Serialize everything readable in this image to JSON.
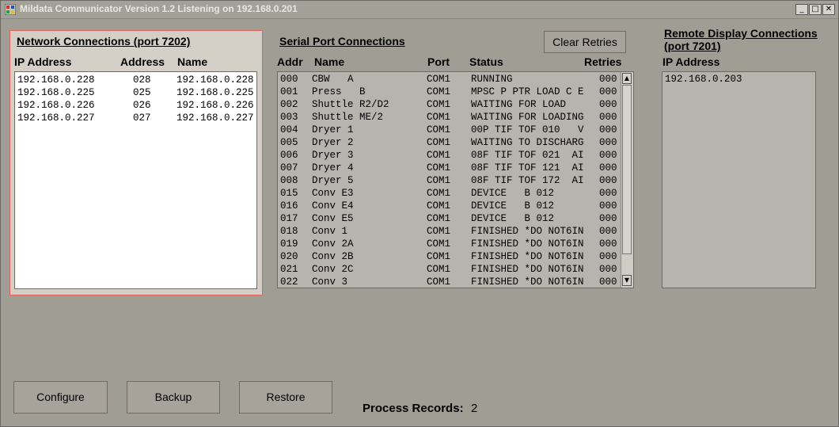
{
  "window": {
    "title": "Mildata Communicator Version 1.2 Listening on 192.168.0.201",
    "minimize": "_",
    "maximize": "□",
    "close": "✕"
  },
  "network": {
    "title": "Network Connections (port 7202)",
    "headers": {
      "ip": "IP Address",
      "address": "Address",
      "name": "Name"
    },
    "rows": [
      {
        "ip": "192.168.0.228",
        "address": "028",
        "name": "192.168.0.228"
      },
      {
        "ip": "192.168.0.225",
        "address": "025",
        "name": "192.168.0.225"
      },
      {
        "ip": "192.168.0.226",
        "address": "026",
        "name": "192.168.0.226"
      },
      {
        "ip": "192.168.0.227",
        "address": "027",
        "name": "192.168.0.227"
      }
    ]
  },
  "serial": {
    "title": "Serial Port Connections",
    "clear_retries": "Clear Retries",
    "headers": {
      "addr": "Addr",
      "name": "Name",
      "port": "Port",
      "status": "Status",
      "retries": "Retries"
    },
    "rows": [
      {
        "addr": "000",
        "name": "CBW   A",
        "port": "COM1",
        "status": "RUNNING",
        "retries": "000"
      },
      {
        "addr": "001",
        "name": "Press   B",
        "port": "COM1",
        "status": "MPSC P PTR LOAD C E",
        "retries": "000"
      },
      {
        "addr": "002",
        "name": "Shuttle R2/D2",
        "port": "COM1",
        "status": "WAITING FOR LOAD",
        "retries": "000"
      },
      {
        "addr": "003",
        "name": "Shuttle ME/2",
        "port": "COM1",
        "status": "WAITING FOR LOADING",
        "retries": "000"
      },
      {
        "addr": "004",
        "name": "Dryer 1",
        "port": "COM1",
        "status": "00P TIF TOF 010   V",
        "retries": "000"
      },
      {
        "addr": "005",
        "name": "Dryer 2",
        "port": "COM1",
        "status": "WAITING TO DISCHARG",
        "retries": "000"
      },
      {
        "addr": "006",
        "name": "Dryer 3",
        "port": "COM1",
        "status": "08F TIF TOF 021  AI",
        "retries": "000"
      },
      {
        "addr": "007",
        "name": "Dryer 4",
        "port": "COM1",
        "status": "08F TIF TOF 121  AI",
        "retries": "000"
      },
      {
        "addr": "008",
        "name": "Dryer 5",
        "port": "COM1",
        "status": "08F TIF TOF 172  AI",
        "retries": "000"
      },
      {
        "addr": "015",
        "name": "Conv E3",
        "port": "COM1",
        "status": "DEVICE   B 012",
        "retries": "000"
      },
      {
        "addr": "016",
        "name": "Conv E4",
        "port": "COM1",
        "status": "DEVICE   B 012",
        "retries": "000"
      },
      {
        "addr": "017",
        "name": "Conv E5",
        "port": "COM1",
        "status": "DEVICE   B 012",
        "retries": "000"
      },
      {
        "addr": "018",
        "name": "Conv 1",
        "port": "COM1",
        "status": "FINISHED *DO NOT6IN",
        "retries": "000"
      },
      {
        "addr": "019",
        "name": "Conv 2A",
        "port": "COM1",
        "status": "FINISHED *DO NOT6IN",
        "retries": "000"
      },
      {
        "addr": "020",
        "name": "Conv 2B",
        "port": "COM1",
        "status": "FINISHED *DO NOT6IN",
        "retries": "000"
      },
      {
        "addr": "021",
        "name": "Conv 2C",
        "port": "COM1",
        "status": "FINISHED *DO NOT6IN",
        "retries": "000"
      },
      {
        "addr": "022",
        "name": "Conv 3",
        "port": "COM1",
        "status": "FINISHED *DO NOT6IN",
        "retries": "000"
      }
    ],
    "scroll_up": "▲",
    "scroll_down": "▼"
  },
  "remote": {
    "title": "Remote Display Connections (port 7201)",
    "header": "IP Address",
    "rows": [
      "192.168.0.203"
    ]
  },
  "footer": {
    "configure": "Configure",
    "backup": "Backup",
    "restore": "Restore",
    "process_label": "Process Records:",
    "process_value": "2"
  }
}
